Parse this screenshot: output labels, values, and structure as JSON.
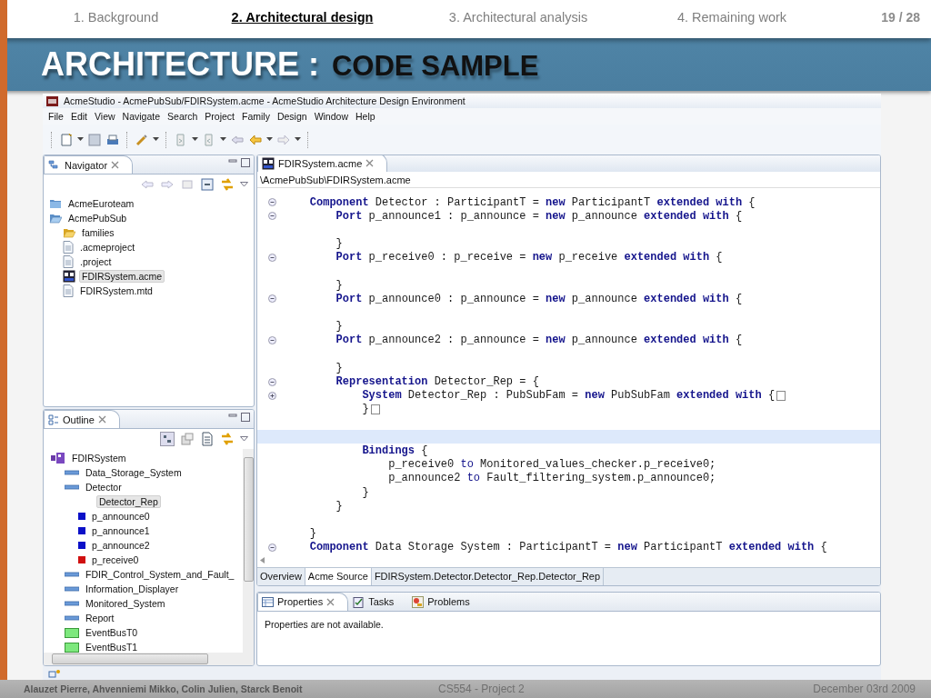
{
  "slide_nav": [
    {
      "label": "1. Background",
      "selected": false
    },
    {
      "label": "2. Architectural design",
      "selected": true
    },
    {
      "label": "3. Architectural analysis",
      "selected": false
    },
    {
      "label": "4. Remaining work",
      "selected": false
    }
  ],
  "page": "19 / 28",
  "title": {
    "main": "ARCHITECTURE :",
    "sub": "CODE SAMPLE"
  },
  "window": {
    "title": "AcmeStudio - AcmePubSub/FDIRSystem.acme - AcmeStudio Architecture Design Environment"
  },
  "menu": [
    "File",
    "Edit",
    "View",
    "Navigate",
    "Search",
    "Project",
    "Family",
    "Design",
    "Window",
    "Help"
  ],
  "navigator": {
    "title": "Navigator",
    "tree": [
      {
        "label": "AcmeEuroteam",
        "kind": "project",
        "expanded": false,
        "selected": false
      },
      {
        "label": "AcmePubSub",
        "kind": "project",
        "expanded": true,
        "selected": false,
        "children": [
          {
            "label": "families",
            "kind": "folder",
            "selected": false
          },
          {
            "label": ".acmeproject",
            "kind": "file",
            "selected": false
          },
          {
            "label": ".project",
            "kind": "file",
            "selected": false
          },
          {
            "label": "FDIRSystem.acme",
            "kind": "acme",
            "selected": true
          },
          {
            "label": "FDIRSystem.mtd",
            "kind": "file",
            "selected": false
          }
        ]
      }
    ]
  },
  "outline": {
    "title": "Outline",
    "tree": [
      {
        "label": "FDIRSystem",
        "kind": "system",
        "selected": false,
        "children": [
          {
            "label": "Data_Storage_System",
            "kind": "component",
            "selected": false
          },
          {
            "label": "Detector",
            "kind": "component",
            "selected": false,
            "children": [
              {
                "label": "Detector_Rep",
                "kind": "representation",
                "selected": true
              },
              {
                "label": "p_announce0",
                "kind": "port",
                "color": "#0a10c8",
                "selected": false
              },
              {
                "label": "p_announce1",
                "kind": "port",
                "color": "#0a10c8",
                "selected": false
              },
              {
                "label": "p_announce2",
                "kind": "port",
                "color": "#0a10c8",
                "selected": false
              },
              {
                "label": "p_receive0",
                "kind": "port",
                "color": "#d01010",
                "selected": false
              }
            ]
          },
          {
            "label": "FDIR_Control_System_and_Fault_",
            "kind": "component",
            "selected": false
          },
          {
            "label": "Information_Displayer",
            "kind": "component",
            "selected": false
          },
          {
            "label": "Monitored_System",
            "kind": "component",
            "selected": false
          },
          {
            "label": "Report",
            "kind": "component",
            "selected": false
          },
          {
            "label": "EventBusT0",
            "kind": "bus",
            "selected": false
          },
          {
            "label": "EventBusT1",
            "kind": "bus",
            "selected": false
          }
        ]
      }
    ]
  },
  "editor": {
    "tab": "FDIRSystem.acme",
    "path": "\\AcmePubSub\\FDIRSystem.acme",
    "lines": [
      {
        "foldable": true,
        "current": false,
        "collapsed": false,
        "tokens": [
          {
            "kind": "keyword",
            "text": "    Component"
          },
          {
            "kind": "plain",
            "text": " Detector : ParticipantT = "
          },
          {
            "kind": "keyword",
            "text": "new"
          },
          {
            "kind": "plain",
            "text": " ParticipantT "
          },
          {
            "kind": "keyword",
            "text": "extended with"
          },
          {
            "kind": "plain",
            "text": " {"
          }
        ]
      },
      {
        "foldable": true,
        "current": false,
        "collapsed": false,
        "tokens": [
          {
            "kind": "keyword",
            "text": "        Port"
          },
          {
            "kind": "plain",
            "text": " p_announce1 : p_announce = "
          },
          {
            "kind": "keyword",
            "text": "new"
          },
          {
            "kind": "plain",
            "text": " p_announce "
          },
          {
            "kind": "keyword",
            "text": "extended with"
          },
          {
            "kind": "plain",
            "text": " {"
          }
        ]
      },
      {
        "foldable": false,
        "current": false,
        "collapsed": false
      },
      {
        "foldable": false,
        "current": false,
        "collapsed": false,
        "tokens": [
          {
            "kind": "plain",
            "text": "        }"
          }
        ]
      },
      {
        "foldable": true,
        "current": false,
        "collapsed": false,
        "tokens": [
          {
            "kind": "keyword",
            "text": "        Port"
          },
          {
            "kind": "plain",
            "text": " p_receive0 : p_receive = "
          },
          {
            "kind": "keyword",
            "text": "new"
          },
          {
            "kind": "plain",
            "text": " p_receive "
          },
          {
            "kind": "keyword",
            "text": "extended with"
          },
          {
            "kind": "plain",
            "text": " {"
          }
        ]
      },
      {
        "foldable": false,
        "current": false,
        "collapsed": false
      },
      {
        "foldable": false,
        "current": false,
        "collapsed": false,
        "tokens": [
          {
            "kind": "plain",
            "text": "        }"
          }
        ]
      },
      {
        "foldable": true,
        "current": false,
        "collapsed": false,
        "tokens": [
          {
            "kind": "keyword",
            "text": "        Port"
          },
          {
            "kind": "plain",
            "text": " p_announce0 : p_announce = "
          },
          {
            "kind": "keyword",
            "text": "new"
          },
          {
            "kind": "plain",
            "text": " p_announce "
          },
          {
            "kind": "keyword",
            "text": "extended with"
          },
          {
            "kind": "plain",
            "text": " {"
          }
        ]
      },
      {
        "foldable": false,
        "current": false,
        "collapsed": false
      },
      {
        "foldable": false,
        "current": false,
        "collapsed": false,
        "tokens": [
          {
            "kind": "plain",
            "text": "        }"
          }
        ]
      },
      {
        "foldable": true,
        "current": false,
        "collapsed": false,
        "tokens": [
          {
            "kind": "keyword",
            "text": "        Port"
          },
          {
            "kind": "plain",
            "text": " p_announce2 : p_announce = "
          },
          {
            "kind": "keyword",
            "text": "new"
          },
          {
            "kind": "plain",
            "text": " p_announce "
          },
          {
            "kind": "keyword",
            "text": "extended with"
          },
          {
            "kind": "plain",
            "text": " {"
          }
        ]
      },
      {
        "foldable": false,
        "current": false,
        "collapsed": false
      },
      {
        "foldable": false,
        "current": false,
        "collapsed": false,
        "tokens": [
          {
            "kind": "plain",
            "text": "        }"
          }
        ]
      },
      {
        "foldable": true,
        "current": false,
        "collapsed": false,
        "tokens": [
          {
            "kind": "keyword",
            "text": "        Representation"
          },
          {
            "kind": "plain",
            "text": " Detector_Rep = {"
          }
        ]
      },
      {
        "foldable": true,
        "current": false,
        "collapsed": true,
        "tokens": [
          {
            "kind": "keyword",
            "text": "            System"
          },
          {
            "kind": "plain",
            "text": " Detector_Rep : PubSubFam = "
          },
          {
            "kind": "keyword",
            "text": "new"
          },
          {
            "kind": "plain",
            "text": " PubSubFam "
          },
          {
            "kind": "keyword",
            "text": "extended with"
          },
          {
            "kind": "plain",
            "text": " {"
          }
        ]
      },
      {
        "foldable": false,
        "current": false,
        "collapsed": true,
        "tokens": [
          {
            "kind": "plain",
            "text": "            }"
          }
        ]
      },
      {
        "foldable": false,
        "current": false,
        "collapsed": false
      },
      {
        "foldable": false,
        "current": true,
        "collapsed": false
      },
      {
        "foldable": false,
        "current": false,
        "collapsed": false,
        "tokens": [
          {
            "kind": "keyword",
            "text": "            Bindings"
          },
          {
            "kind": "plain",
            "text": " {"
          }
        ]
      },
      {
        "foldable": false,
        "current": false,
        "collapsed": false,
        "tokens": [
          {
            "kind": "plain",
            "text": "                p_receive0 "
          },
          {
            "kind": "keyword",
            "text": "to"
          },
          {
            "kind": "plain",
            "text": " Monitored_values_checker.p_receive0;"
          }
        ]
      },
      {
        "foldable": false,
        "current": false,
        "collapsed": false,
        "tokens": [
          {
            "kind": "plain",
            "text": "                p_announce2 "
          },
          {
            "kind": "keyword",
            "text": "to"
          },
          {
            "kind": "plain",
            "text": " Fault_filtering_system.p_announce0;"
          }
        ]
      },
      {
        "foldable": false,
        "current": false,
        "collapsed": false,
        "tokens": [
          {
            "kind": "plain",
            "text": "            }"
          }
        ]
      },
      {
        "foldable": false,
        "current": false,
        "collapsed": false,
        "tokens": [
          {
            "kind": "plain",
            "text": "        }"
          }
        ]
      },
      {
        "foldable": false,
        "current": false,
        "collapsed": false
      },
      {
        "foldable": false,
        "current": false,
        "collapsed": false,
        "tokens": [
          {
            "kind": "plain",
            "text": "    }"
          }
        ]
      },
      {
        "foldable": true,
        "current": false,
        "collapsed": false,
        "tokens": [
          {
            "kind": "keyword",
            "text": "    Component"
          },
          {
            "kind": "plain",
            "text": " Data Storage System : ParticipantT = "
          },
          {
            "kind": "keyword",
            "text": "new"
          },
          {
            "kind": "plain",
            "text": " ParticipantT "
          },
          {
            "kind": "keyword",
            "text": "extended with"
          },
          {
            "kind": "plain",
            "text": " {"
          }
        ]
      }
    ],
    "pages": [
      {
        "label": "Overview",
        "selected": false
      },
      {
        "label": "Acme Source",
        "selected": true
      },
      {
        "label": "FDIRSystem.Detector.Detector_Rep.Detector_Rep",
        "selected": false
      }
    ]
  },
  "views": {
    "tabs": [
      {
        "label": "Properties",
        "kind": "properties",
        "selected": true
      },
      {
        "label": "Tasks",
        "kind": "tasks",
        "selected": false
      },
      {
        "label": "Problems",
        "kind": "problems",
        "selected": false
      }
    ],
    "message": "Properties are not available."
  },
  "footer": {
    "authors": "Alauzet Pierre, Ahvenniemi Mikko, Colin Julien, Starck Benoit",
    "course": "CS554 - Project 2",
    "date": "December 03rd 2009"
  }
}
